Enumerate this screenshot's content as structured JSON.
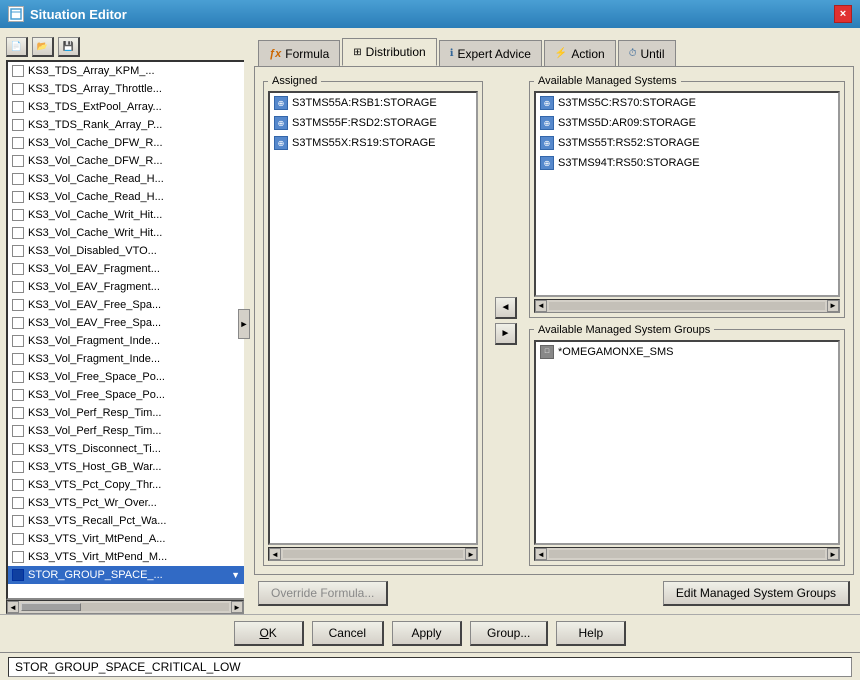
{
  "titlebar": {
    "title": "Situation Editor",
    "close_label": "×"
  },
  "tabs": [
    {
      "id": "formula",
      "label": "Formula",
      "icon": "fx"
    },
    {
      "id": "distribution",
      "label": "Distribution",
      "icon": "grid",
      "active": true
    },
    {
      "id": "expert_advice",
      "label": "Expert Advice",
      "icon": "info"
    },
    {
      "id": "action",
      "label": "Action",
      "icon": "bolt"
    },
    {
      "id": "until",
      "label": "Until",
      "icon": "clock"
    }
  ],
  "left_panel": {
    "items": [
      "KS3_TDS_Array_KPM_...",
      "KS3_TDS_Array_Throttle...",
      "KS3_TDS_ExtPool_Array...",
      "KS3_TDS_Rank_Array_P...",
      "KS3_Vol_Cache_DFW_R...",
      "KS3_Vol_Cache_DFW_R...",
      "KS3_Vol_Cache_Read_H...",
      "KS3_Vol_Cache_Read_H...",
      "KS3_Vol_Cache_Writ_Hit...",
      "KS3_Vol_Cache_Writ_Hit...",
      "KS3_Vol_Disabled_VTO...",
      "KS3_Vol_EAV_Fragment...",
      "KS3_Vol_EAV_Fragment...",
      "KS3_Vol_EAV_Free_Spa...",
      "KS3_Vol_EAV_Free_Spa...",
      "KS3_Vol_Fragment_Inde...",
      "KS3_Vol_Fragment_Inde...",
      "KS3_Vol_Free_Space_Po...",
      "KS3_Vol_Free_Space_Po...",
      "KS3_Vol_Perf_Resp_Tim...",
      "KS3_Vol_Perf_Resp_Tim...",
      "KS3_VTS_Disconnect_Ti...",
      "KS3_VTS_Host_GB_War...",
      "KS3_VTS_Pct_Copy_Thr...",
      "KS3_VTS_Pct_Wr_Over...",
      "KS3_VTS_Recall_Pct_Wa...",
      "KS3_VTS_Virt_MtPend_A...",
      "KS3_VTS_Virt_MtPend_M..."
    ],
    "selected_item": "STOR_GROUP_SPACE_..."
  },
  "distribution": {
    "assigned_label": "Assigned",
    "assigned_items": [
      {
        "label": "S3TMS55A:RSB1:STORAGE"
      },
      {
        "label": "S3TMS55F:RSD2:STORAGE"
      },
      {
        "label": "S3TMS55X:RS19:STORAGE"
      }
    ],
    "available_systems_label": "Available Managed Systems",
    "available_systems": [
      {
        "label": "S3TMS5C:RS70:STORAGE"
      },
      {
        "label": "S3TMS5D:AR09:STORAGE"
      },
      {
        "label": "S3TMS55T:RS52:STORAGE"
      },
      {
        "label": "S3TMS94T:RS50:STORAGE"
      }
    ],
    "available_groups_label": "Available Managed System Groups",
    "available_groups": [
      {
        "label": "*OMEGAMONXE_SMS"
      }
    ],
    "arrow_left": "◄",
    "arrow_right": "►",
    "override_formula_label": "Override Formula...",
    "edit_groups_label": "Edit Managed System Groups"
  },
  "footer": {
    "ok_label": "OK",
    "cancel_label": "Cancel",
    "apply_label": "Apply",
    "group_label": "Group...",
    "help_label": "Help"
  },
  "status_bar": {
    "text": "STOR_GROUP_SPACE_CRITICAL_LOW"
  }
}
